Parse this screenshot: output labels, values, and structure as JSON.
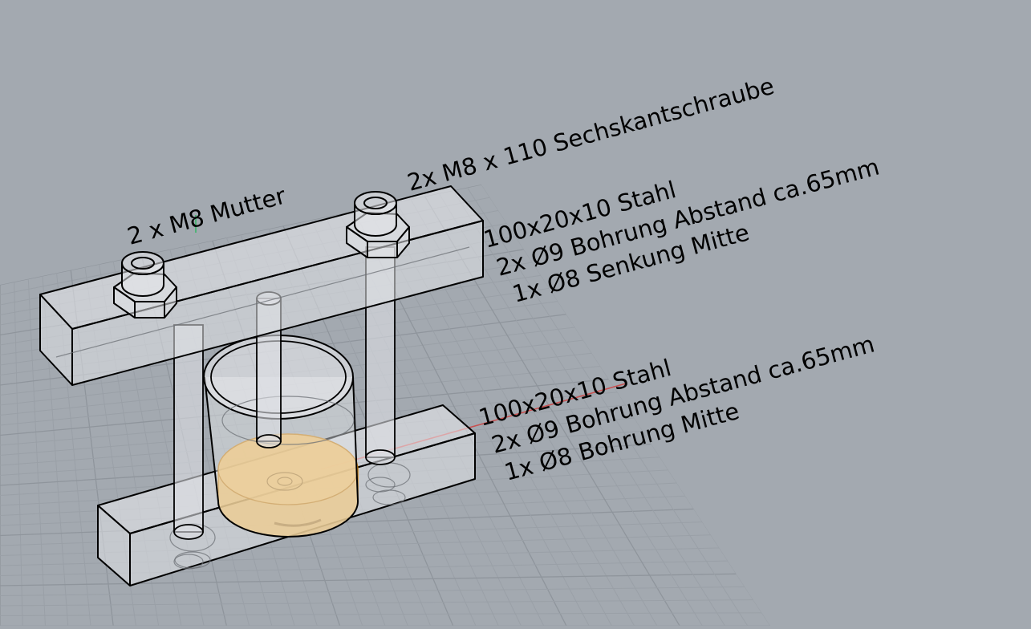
{
  "labels": {
    "nuts": "2 x M8 Mutter",
    "bolts": "2x M8 x 110 Sechskantschraube",
    "top_plate": [
      "100x20x10 Stahl",
      "2x Ø9 Bohrung Abstand ca.65mm",
      "1x Ø8 Senkung Mitte"
    ],
    "bottom_plate": [
      "100x20x10 Stahl",
      "2x Ø9 Bohrung Abstand ca.65mm",
      "1x Ø8 Bohrung Mitte"
    ]
  },
  "colors": {
    "background": "#a3a9b0",
    "grid": "#9aa0a7",
    "highlight": "#f0b040",
    "x_axis": "#c85050",
    "y_axis": "#3bb56a"
  }
}
